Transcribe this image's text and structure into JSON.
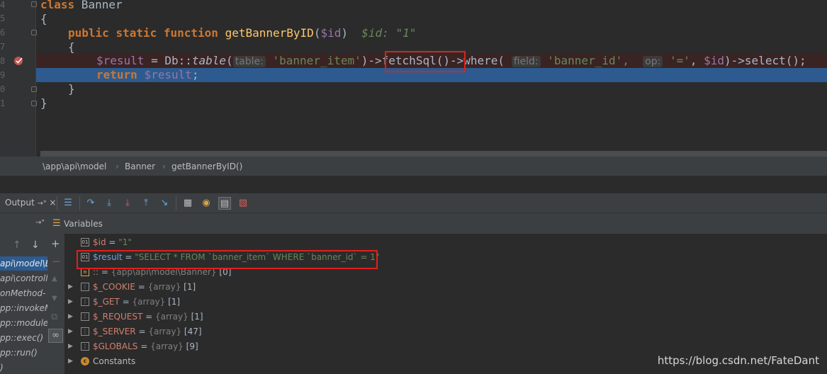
{
  "editor": {
    "line_numbers": [
      "4",
      "5",
      "6",
      "7",
      "8",
      "9",
      "0",
      "1"
    ],
    "line4": {
      "kw": "class",
      "name": " Banner"
    },
    "line5": "{",
    "line6": {
      "kw1": "public",
      "kw2": "static",
      "kw3": "function",
      "fn": "getBannerByID",
      "open": "(",
      "param": "$id",
      "close": ")",
      "inline": "$id: \"1\""
    },
    "line7": "{",
    "line8": {
      "var": "$result",
      "eq": " = Db::",
      "method": "table",
      "open": "(",
      "hint_table": "table:",
      "arg1": "'banner_item'",
      "mid1": ")-",
      "fetch": ">fetchSql()-",
      "mid2": ">where(",
      "hint_field": "field:",
      "arg2": "'banner_id',",
      "hint_op": "op:",
      "arg3": "'='",
      "comma": ", ",
      "param": "$id",
      "tail": ")->select();"
    },
    "line9": {
      "kw": "return",
      "var": "$result",
      "semi": ";"
    },
    "line10": "}",
    "line11": "}"
  },
  "breadcrumb": [
    "\\app\\api\\model",
    "Banner",
    "getBannerByID()"
  ],
  "toolbar": {
    "output_tab": "Output",
    "pin": "→\"",
    "close": "×"
  },
  "vars_header": {
    "pin": "→\"",
    "label": "Variables"
  },
  "frames": [
    "api\\model\\B",
    "api\\controlle",
    "onMethod-",
    "pp::invokeM",
    "pp::module",
    "pp::exec()",
    "pp::run()",
    ")"
  ],
  "variables": [
    {
      "name": "$id",
      "eq": " = ",
      "value": "\"1\"",
      "kind": "str",
      "expand": false,
      "icon": "var"
    },
    {
      "name": "$result",
      "eq": " = ",
      "value": "\"SELECT * FROM `banner_item` WHERE  `banner_id` = 1\"",
      "kind": "str",
      "expand": false,
      "icon": "var"
    },
    {
      "name": "::",
      "eq": " = ",
      "type": "{app\\api\\model\\Banner}",
      "count": "[0]",
      "kind": "obj",
      "expand": false,
      "icon": "list"
    },
    {
      "name": "$_COOKIE",
      "eq": " = ",
      "type": "{array}",
      "count": "[1]",
      "kind": "arr",
      "expand": true,
      "icon": "array"
    },
    {
      "name": "$_GET",
      "eq": " = ",
      "type": "{array}",
      "count": "[1]",
      "kind": "arr",
      "expand": true,
      "icon": "array"
    },
    {
      "name": "$_REQUEST",
      "eq": " = ",
      "type": "{array}",
      "count": "[1]",
      "kind": "arr",
      "expand": true,
      "icon": "array"
    },
    {
      "name": "$_SERVER",
      "eq": " = ",
      "type": "{array}",
      "count": "[47]",
      "kind": "arr",
      "expand": true,
      "icon": "array"
    },
    {
      "name": "$GLOBALS",
      "eq": " = ",
      "type": "{array}",
      "count": "[9]",
      "kind": "arr",
      "expand": true,
      "icon": "array"
    },
    {
      "name": "Constants",
      "eq": "",
      "type": "",
      "count": "",
      "kind": "const",
      "expand": true,
      "icon": "constants"
    }
  ],
  "watermark": "https://blog.csdn.net/FateDant",
  "colors": {
    "exec_line": "#2d5b8f",
    "highlight_box": "#e0201b",
    "breakpoint": "#c75450"
  }
}
